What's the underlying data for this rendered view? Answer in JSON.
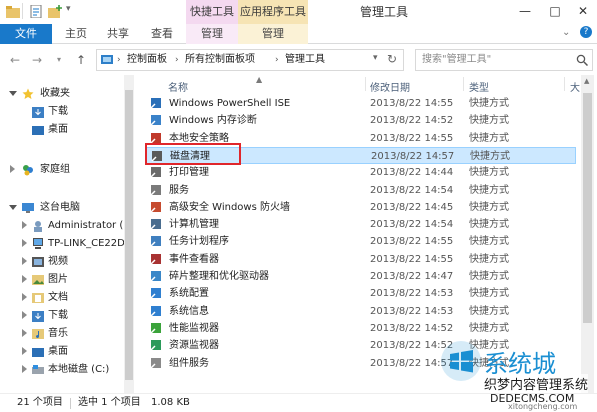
{
  "window": {
    "title": "管理工具"
  },
  "context_groups": {
    "quick_tools": "快捷工具",
    "app_tools": "应用程序工具"
  },
  "ribbon": {
    "tabs": [
      "文件",
      "主页",
      "共享",
      "查看",
      "管理",
      "管理"
    ]
  },
  "address": {
    "crumbs": [
      "控制面板",
      "所有控制面板项",
      "管理工具"
    ]
  },
  "search": {
    "placeholder": "搜索\"管理工具\""
  },
  "nav": {
    "favorites": "收藏夹",
    "downloads": "下载",
    "desktop": "桌面",
    "homegroup": "家庭组",
    "this_pc": "这台电脑",
    "administrator": "Administrator (",
    "tplink": "TP-LINK_CE22D",
    "videos": "视频",
    "pictures": "图片",
    "documents": "文档",
    "downloads2": "下载",
    "music": "音乐",
    "desktop2": "桌面",
    "local_disk": "本地磁盘 (C:)"
  },
  "columns": {
    "name": "名称",
    "modified": "修改日期",
    "type": "类型",
    "size": "大"
  },
  "files": [
    {
      "name": "Windows PowerShell ISE",
      "date": "2013/8/22 14:55",
      "type": "快捷方式"
    },
    {
      "name": "Windows 内存诊断",
      "date": "2013/8/22 14:52",
      "type": "快捷方式"
    },
    {
      "name": "本地安全策略",
      "date": "2013/8/22 14:55",
      "type": "快捷方式"
    },
    {
      "name": "磁盘清理",
      "date": "2013/8/22 14:57",
      "type": "快捷方式"
    },
    {
      "name": "打印管理",
      "date": "2013/8/22 14:44",
      "type": "快捷方式"
    },
    {
      "name": "服务",
      "date": "2013/8/22 14:54",
      "type": "快捷方式"
    },
    {
      "name": "高级安全 Windows 防火墙",
      "date": "2013/8/22 14:45",
      "type": "快捷方式"
    },
    {
      "name": "计算机管理",
      "date": "2013/8/22 14:54",
      "type": "快捷方式"
    },
    {
      "name": "任务计划程序",
      "date": "2013/8/22 14:55",
      "type": "快捷方式"
    },
    {
      "name": "事件查看器",
      "date": "2013/8/22 14:55",
      "type": "快捷方式"
    },
    {
      "name": "碎片整理和优化驱动器",
      "date": "2013/8/22 14:47",
      "type": "快捷方式"
    },
    {
      "name": "系统配置",
      "date": "2013/8/22 14:53",
      "type": "快捷方式"
    },
    {
      "name": "系统信息",
      "date": "2013/8/22 14:53",
      "type": "快捷方式"
    },
    {
      "name": "性能监视器",
      "date": "2013/8/22 14:52",
      "type": "快捷方式"
    },
    {
      "name": "资源监视器",
      "date": "2013/8/22 14:52",
      "type": "快捷方式"
    },
    {
      "name": "组件服务",
      "date": "2013/8/22 14:57",
      "type": "快捷方式"
    }
  ],
  "status": {
    "count": "21 个项目",
    "selected": "选中 1 个项目",
    "size": "1.08 KB"
  },
  "watermark": {
    "brand": "系统城",
    "subtitle": "织梦内容管理系统",
    "url": "DEDECMS.COM",
    "pinyin": "xitongcheng.com"
  },
  "colors": {
    "accent": "#1979ca",
    "selection": "#cce8ff",
    "highlight_box": "#e0262b"
  }
}
